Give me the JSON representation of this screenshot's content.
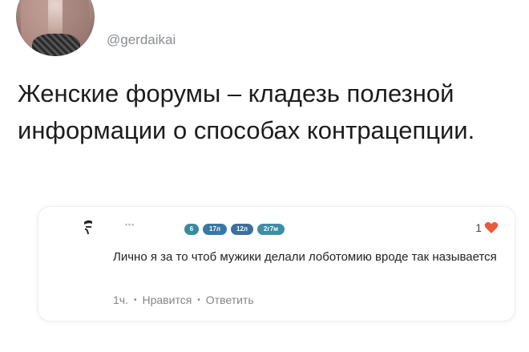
{
  "tweet": {
    "handle": "@gerdaikai",
    "text": "Женские форумы – кладезь полезной информации о способах контрацепции."
  },
  "comment": {
    "author": "...",
    "badges": [
      "6",
      "17л",
      "12л",
      "2г7м"
    ],
    "likes": "1",
    "text": "Лично я за то чтоб мужики делали лоботомию вроде так называется",
    "time": "1ч.",
    "like_action": "Нравится",
    "reply_action": "Ответить",
    "heart_color": "#e8593e"
  }
}
